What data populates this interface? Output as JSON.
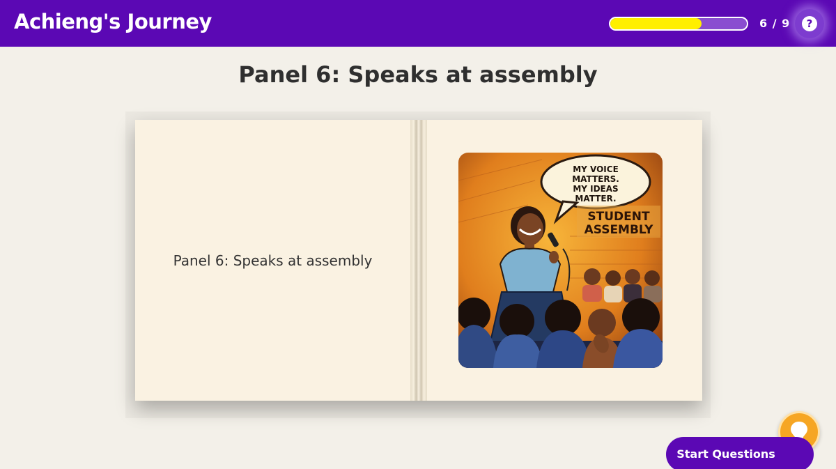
{
  "header": {
    "title": "Achieng's Journey",
    "progress_fraction": 0.67,
    "progress_text": "6 / 9",
    "help_glyph": "?"
  },
  "panel": {
    "heading": "Panel 6: Speaks at assembly",
    "caption": "Panel 6: Speaks at assembly",
    "illustration": {
      "speech_bubble_line1": "MY VOICE",
      "speech_bubble_line2": "MATTERS.",
      "speech_bubble_line3": "MY IDEAS",
      "speech_bubble_line4": "MATTER.",
      "sign_line1": "STUDENT",
      "sign_line2": "ASSEMBLY"
    }
  },
  "actions": {
    "start_label": "Start Questions",
    "hint_icon": "lightbulb-icon"
  },
  "colors": {
    "brand": "#5b08b4",
    "progress": "#ffef00",
    "hint": "#f6a623",
    "background": "#f3f0e9"
  }
}
